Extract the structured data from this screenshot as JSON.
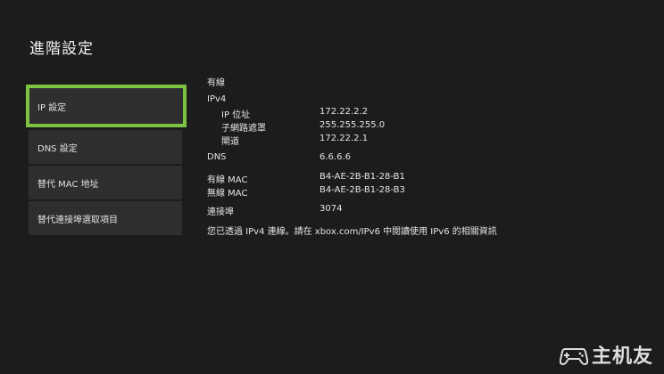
{
  "page": {
    "title": "進階設定"
  },
  "menu": {
    "items": [
      {
        "label": "IP 設定"
      },
      {
        "label": "DNS 設定"
      },
      {
        "label": "替代 MAC 地址"
      },
      {
        "label": "替代連接埠選取項目"
      }
    ]
  },
  "details": {
    "connection_type": "有線",
    "ipv4_header": "IPv4",
    "ip_label": "IP 位址",
    "ip_value": "172.22.2.2",
    "subnet_label": "子網路遮罩",
    "subnet_value": "255.255.255.0",
    "gateway_label": "閘道",
    "gateway_value": "172.22.2.1",
    "dns_label": "DNS",
    "dns_value": "6.6.6.6",
    "wired_mac_label": "有線 MAC",
    "wired_mac_value": "B4-AE-2B-B1-28-B1",
    "wireless_mac_label": "無線 MAC",
    "wireless_mac_value": "B4-AE-2B-B1-28-B3",
    "port_label": "連接埠",
    "port_value": "3074",
    "note": "您已透過 IPv4 連線。請在 xbox.com/IPv6 中閱讀使用 IPv6 的相關資訊"
  },
  "watermark": {
    "text": "主机友",
    "icon": "gamepad-icon"
  },
  "colors": {
    "background": "#1c1c1c",
    "menu_item": "#2e2e2e",
    "selection_outline": "#7dc241",
    "text": "#e6e6e6"
  }
}
